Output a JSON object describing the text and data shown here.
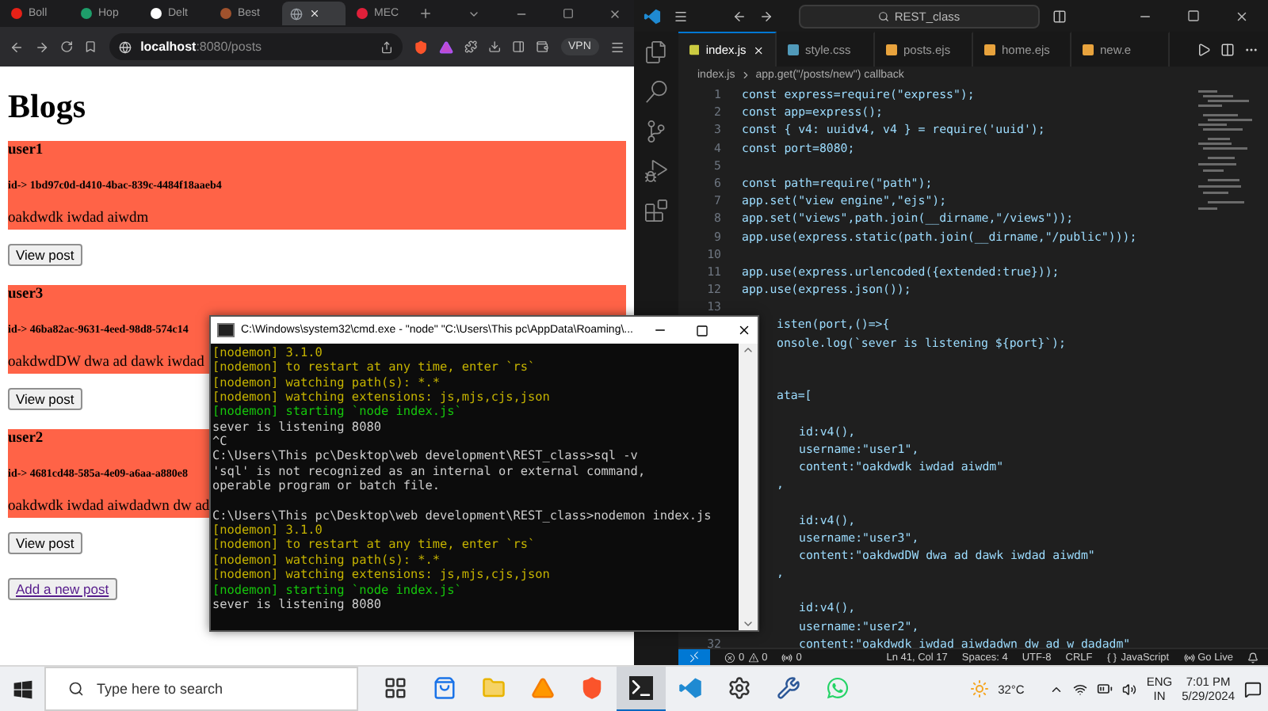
{
  "browser": {
    "tabs": [
      {
        "label": "Boll",
        "color": "#e62117",
        "selected": false
      },
      {
        "label": "Hop",
        "color": "#1e9e6a",
        "selected": false
      },
      {
        "label": "Delt",
        "color": "#ffffff",
        "selected": false
      },
      {
        "label": "Best",
        "color": "#a0522d",
        "selected": false
      },
      {
        "color": "#9aa0a6",
        "selected": true
      },
      {
        "label": "MEC",
        "color": "#e0203a",
        "selected": false
      }
    ],
    "address": {
      "host": "localhost",
      "path": ":8080/posts"
    },
    "vpn": "VPN",
    "page": {
      "heading": "Blogs",
      "posts": [
        {
          "username": "user1",
          "id": "id-> 1bd97c0d-d410-4bac-839c-4484f18aaeb4",
          "content": "oakdwdk iwdad aiwdm",
          "button": "View post"
        },
        {
          "username": "user3",
          "id": "id-> 46ba82ac-9631-4eed-98d8-574c14",
          "content": "oakdwdDW dwa ad dawk iwdad",
          "button": "View post"
        },
        {
          "username": "user2",
          "id": "id-> 4681cd48-585a-4e09-a6aa-a880e8",
          "content": "oakdwdk iwdad aiwdadwn dw ad",
          "button": "View post"
        }
      ],
      "add_link": "Add a new post"
    }
  },
  "editor": {
    "search": "REST_class",
    "tabs": [
      {
        "label": "index.js",
        "kind": "js",
        "selected": true
      },
      {
        "label": "style.css",
        "kind": "css",
        "selected": false
      },
      {
        "label": "posts.ejs",
        "kind": "ejs",
        "selected": false
      },
      {
        "label": "home.ejs",
        "kind": "ejs",
        "selected": false
      },
      {
        "label": "new.e",
        "kind": "ejs",
        "selected": false
      }
    ],
    "breadcrumb": {
      "file": "index.js",
      "symbol": "app.get(\"/posts/new\") callback"
    },
    "lines": [
      {
        "number": "1",
        "kind": "top",
        "text": "const express=require(\"express\");"
      },
      {
        "number": "2",
        "kind": "top",
        "text": "const app=express();"
      },
      {
        "number": "3",
        "kind": "top",
        "text": "const { v4: uuidv4, v4 } = require('uuid');"
      },
      {
        "number": "4",
        "kind": "top",
        "text": "const port=8080;"
      },
      {
        "number": "5",
        "kind": "top"
      },
      {
        "number": "6",
        "kind": "top",
        "text": "const path=require(\"path\");"
      },
      {
        "number": "7",
        "kind": "top",
        "text": "app.set(\"view engine\",\"ejs\");"
      },
      {
        "number": "8",
        "kind": "top",
        "text": "app.set(\"views\",path.join(__dirname,\"/views\"));"
      },
      {
        "number": "9",
        "kind": "top",
        "text": "app.use(express.static(path.join(__dirname,\"/public\")));"
      },
      {
        "number": "10",
        "kind": "top"
      },
      {
        "number": "11",
        "kind": "top",
        "text": "app.use(express.urlencoded({extended:true}));"
      },
      {
        "number": "12",
        "kind": "top",
        "text": "app.use(express.json());"
      },
      {
        "number": "13",
        "kind": "top"
      },
      {
        "kind": "clipped",
        "text": "isten(port,()=>{"
      },
      {
        "kind": "clipped",
        "text": "onsole.log(`sever is listening ${port}`);"
      },
      {
        "kind": "hidden"
      },
      {
        "kind": "hidden"
      },
      {
        "kind": "clipped",
        "text": "ata=["
      },
      {
        "kind": "hidden"
      },
      {
        "kind": "inner",
        "text": "id:v4(),"
      },
      {
        "kind": "inner",
        "text": "username:\"user1\","
      },
      {
        "kind": "inner",
        "text": "content:\"oakdwdk iwdad aiwdm\""
      },
      {
        "kind": "clipped",
        "text": ","
      },
      {
        "kind": "hidden"
      },
      {
        "kind": "inner",
        "text": "id:v4(),"
      },
      {
        "kind": "inner",
        "text": "username:\"user3\","
      },
      {
        "kind": "inner",
        "text": "content:\"oakdwdDW dwa ad dawk iwdad aiwdm\""
      },
      {
        "kind": "clipped",
        "text": ","
      },
      {
        "kind": "hidden"
      },
      {
        "kind": "inner",
        "text": "id:v4(),"
      },
      {
        "kind": "inner",
        "text": "username:\"user2\","
      },
      {
        "number": "32",
        "kind": "inner",
        "text": "content:\"oakdwdk iwdad aiwdadwn dw ad w dadadm\""
      }
    ],
    "status": {
      "errors": "0",
      "warnings": "0",
      "ports": "0",
      "items": [
        "Ln 41, Col 17",
        "Spaces: 4",
        "UTF-8",
        "CRLF"
      ],
      "language": "JavaScript",
      "golive": "Go Live"
    }
  },
  "terminal": {
    "title": "C:\\Windows\\system32\\cmd.exe - \"node\"  \"C:\\Users\\This pc\\AppData\\Roaming\\...",
    "lines": [
      {
        "kind": "warn",
        "text": "[nodemon] 3.1.0"
      },
      {
        "kind": "warn",
        "text": "[nodemon] to restart at any time, enter `rs`"
      },
      {
        "kind": "warn",
        "text": "[nodemon] watching path(s): *.*"
      },
      {
        "kind": "warn",
        "text": "[nodemon] watching extensions: js,mjs,cjs,json"
      },
      {
        "kind": "ok",
        "text": "[nodemon] starting `node index.js`"
      },
      {
        "kind": "plain",
        "text": "sever is listening 8080"
      },
      {
        "kind": "plain",
        "text": "^C"
      },
      {
        "kind": "plain",
        "text": "C:\\Users\\This pc\\Desktop\\web development\\REST_class>sql -v"
      },
      {
        "kind": "plain",
        "text": "'sql' is not recognized as an internal or external command,"
      },
      {
        "kind": "plain",
        "text": "operable program or batch file."
      },
      {
        "kind": "blank"
      },
      {
        "kind": "plain",
        "text": "C:\\Users\\This pc\\Desktop\\web development\\REST_class>nodemon index.js"
      },
      {
        "kind": "warn",
        "text": "[nodemon] 3.1.0"
      },
      {
        "kind": "warn",
        "text": "[nodemon] to restart at any time, enter `rs`"
      },
      {
        "kind": "warn",
        "text": "[nodemon] watching path(s): *.*"
      },
      {
        "kind": "warn",
        "text": "[nodemon] watching extensions: js,mjs,cjs,json"
      },
      {
        "kind": "ok",
        "text": "[nodemon] starting `node index.js`"
      },
      {
        "kind": "plain",
        "text": "sever is listening 8080"
      }
    ]
  },
  "taskbar": {
    "search_placeholder": "Type here to search",
    "apps": [
      {
        "kind": "taskview",
        "selected": false
      },
      {
        "kind": "store",
        "selected": false
      },
      {
        "kind": "files",
        "selected": false
      },
      {
        "kind": "vlc",
        "selected": false
      },
      {
        "kind": "brave",
        "selected": false
      },
      {
        "kind": "terminal",
        "selected": true
      },
      {
        "kind": "vscode",
        "selected": false
      },
      {
        "kind": "settings",
        "selected": false
      },
      {
        "kind": "tool",
        "selected": false
      },
      {
        "kind": "whatsapp",
        "selected": false
      }
    ],
    "weather": "32°C",
    "language": "ENG",
    "region": "IN",
    "time": "7:01 PM",
    "date": "5/29/2024"
  }
}
